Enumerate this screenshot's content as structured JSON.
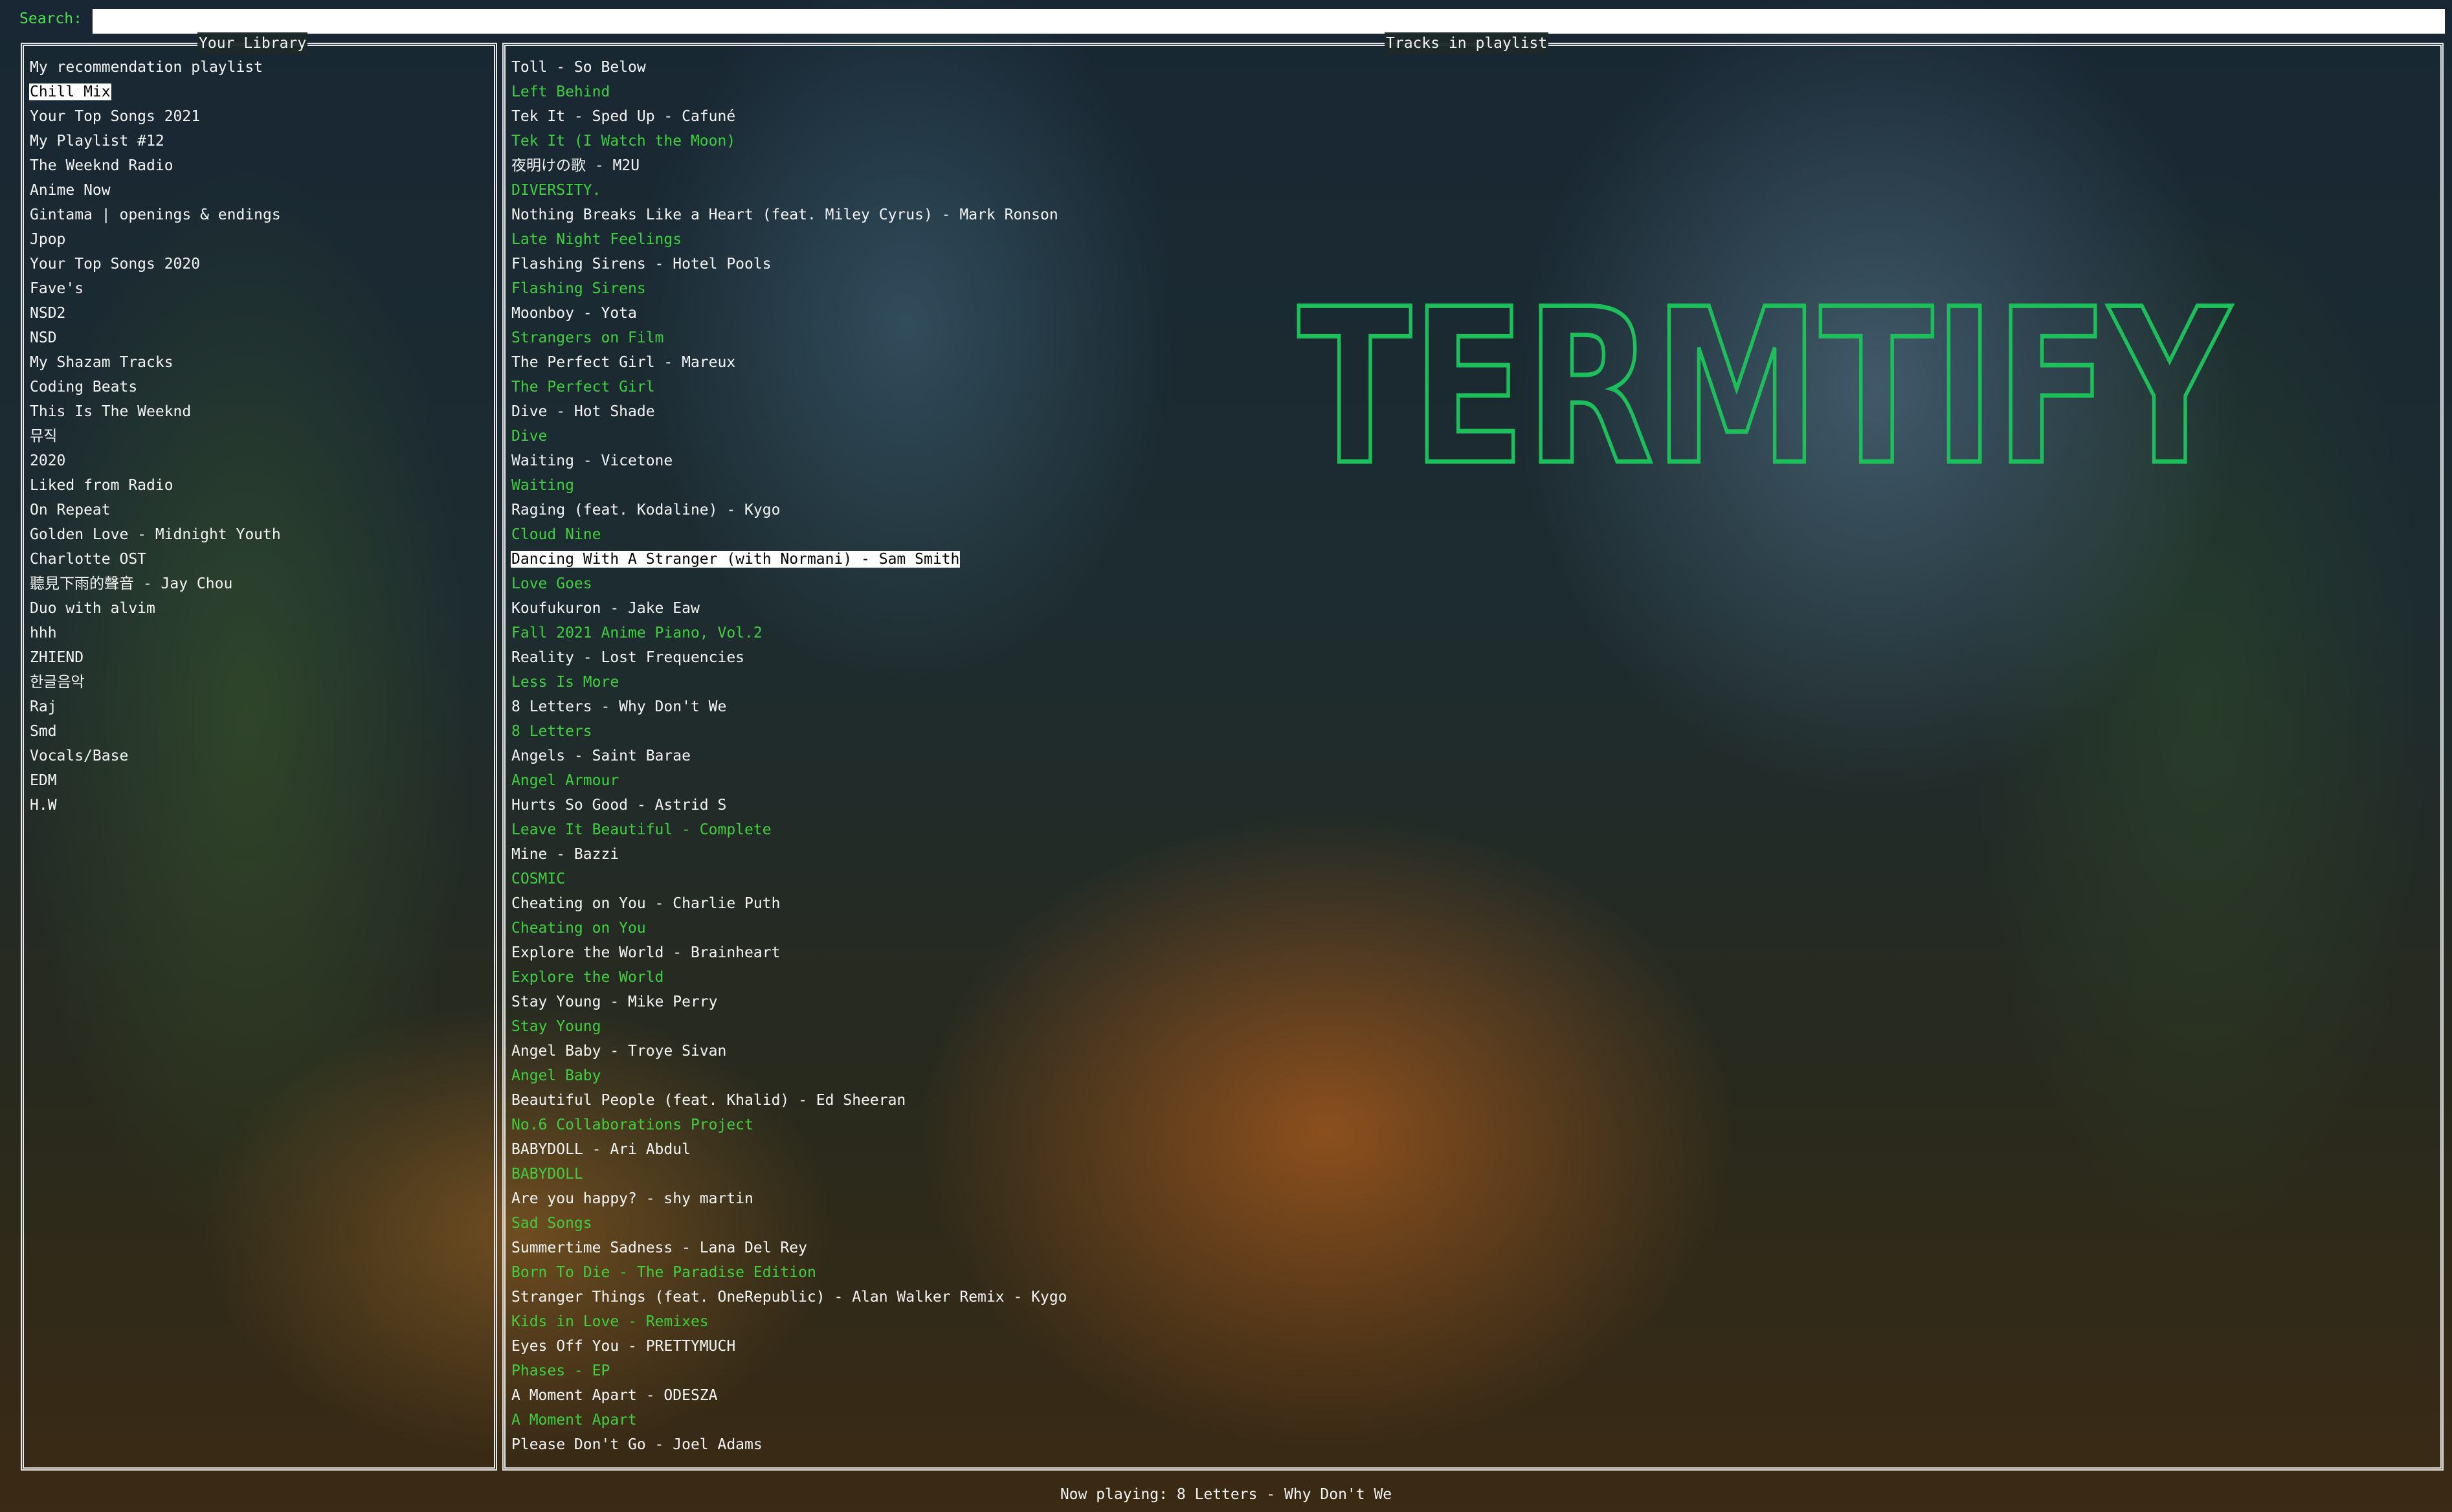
{
  "search": {
    "label": "Search:",
    "value": ""
  },
  "library": {
    "title": "Your Library",
    "selected_index": 1,
    "items": [
      "My recommendation playlist",
      "Chill Mix",
      "Your Top Songs 2021",
      "My Playlist #12",
      "The Weeknd Radio",
      "Anime Now",
      "Gintama | openings & endings",
      "Jpop",
      "Your Top Songs 2020",
      "Fave's",
      "NSD2",
      "NSD",
      "My Shazam Tracks",
      "Coding Beats",
      "This Is The Weeknd",
      "뮤직",
      "2020",
      "Liked from Radio",
      "On Repeat",
      "Golden Love - Midnight Youth",
      "Charlotte OST",
      "聽見下雨的聲音 - Jay Chou",
      "Duo with alvim",
      "hhh",
      "ZHIEND",
      "한글음악",
      "Raj",
      "Smd",
      "Vocals/Base",
      "EDM",
      "H.W"
    ]
  },
  "tracks": {
    "title": "Tracks in playlist",
    "selected_index": 20,
    "items": [
      {
        "text": "Toll - So Below",
        "kind": "track"
      },
      {
        "text": "Left Behind",
        "kind": "album"
      },
      {
        "text": "Tek It - Sped Up - Cafuné",
        "kind": "track"
      },
      {
        "text": "Tek It (I Watch the Moon)",
        "kind": "album"
      },
      {
        "text": "夜明けの歌 - M2U",
        "kind": "track"
      },
      {
        "text": "DIVERSITY.",
        "kind": "album"
      },
      {
        "text": "Nothing Breaks Like a Heart (feat. Miley Cyrus) - Mark Ronson",
        "kind": "track"
      },
      {
        "text": "Late Night Feelings",
        "kind": "album"
      },
      {
        "text": "Flashing Sirens - Hotel Pools",
        "kind": "track"
      },
      {
        "text": "Flashing Sirens",
        "kind": "album"
      },
      {
        "text": "Moonboy - Yota",
        "kind": "track"
      },
      {
        "text": "Strangers on Film",
        "kind": "album"
      },
      {
        "text": "The Perfect Girl - Mareux",
        "kind": "track"
      },
      {
        "text": "The Perfect Girl",
        "kind": "album"
      },
      {
        "text": "Dive - Hot Shade",
        "kind": "track"
      },
      {
        "text": "Dive",
        "kind": "album"
      },
      {
        "text": "Waiting - Vicetone",
        "kind": "track"
      },
      {
        "text": "Waiting",
        "kind": "album"
      },
      {
        "text": "Raging (feat. Kodaline) - Kygo",
        "kind": "track"
      },
      {
        "text": "Cloud Nine",
        "kind": "album"
      },
      {
        "text": "Dancing With A Stranger (with Normani) - Sam Smith",
        "kind": "track"
      },
      {
        "text": "Love Goes",
        "kind": "album"
      },
      {
        "text": "Koufukuron - Jake Eaw",
        "kind": "track"
      },
      {
        "text": "Fall 2021 Anime Piano, Vol.2",
        "kind": "album"
      },
      {
        "text": "Reality - Lost Frequencies",
        "kind": "track"
      },
      {
        "text": "Less Is More",
        "kind": "album"
      },
      {
        "text": "8 Letters - Why Don't We",
        "kind": "track"
      },
      {
        "text": "8 Letters",
        "kind": "album"
      },
      {
        "text": "Angels - Saint Barae",
        "kind": "track"
      },
      {
        "text": "Angel Armour",
        "kind": "album"
      },
      {
        "text": "Hurts So Good - Astrid S",
        "kind": "track"
      },
      {
        "text": "Leave It Beautiful - Complete",
        "kind": "album"
      },
      {
        "text": "Mine - Bazzi",
        "kind": "track"
      },
      {
        "text": "COSMIC",
        "kind": "album"
      },
      {
        "text": "Cheating on You - Charlie Puth",
        "kind": "track"
      },
      {
        "text": "Cheating on You",
        "kind": "album"
      },
      {
        "text": "Explore the World - Brainheart",
        "kind": "track"
      },
      {
        "text": "Explore the World",
        "kind": "album"
      },
      {
        "text": "Stay Young - Mike Perry",
        "kind": "track"
      },
      {
        "text": "Stay Young",
        "kind": "album"
      },
      {
        "text": "Angel Baby - Troye Sivan",
        "kind": "track"
      },
      {
        "text": "Angel Baby",
        "kind": "album"
      },
      {
        "text": "Beautiful People (feat. Khalid) - Ed Sheeran",
        "kind": "track"
      },
      {
        "text": "No.6 Collaborations Project",
        "kind": "album"
      },
      {
        "text": "BABYDOLL - Ari Abdul",
        "kind": "track"
      },
      {
        "text": "BABYDOLL",
        "kind": "album"
      },
      {
        "text": "Are you happy? - shy martin",
        "kind": "track"
      },
      {
        "text": "Sad Songs",
        "kind": "album"
      },
      {
        "text": "Summertime Sadness - Lana Del Rey",
        "kind": "track"
      },
      {
        "text": "Born To Die - The Paradise Edition",
        "kind": "album"
      },
      {
        "text": "Stranger Things (feat. OneRepublic) - Alan Walker Remix - Kygo",
        "kind": "track"
      },
      {
        "text": "Kids in Love - Remixes",
        "kind": "album"
      },
      {
        "text": "Eyes Off You - PRETTYMUCH",
        "kind": "track"
      },
      {
        "text": "Phases - EP",
        "kind": "album"
      },
      {
        "text": "A Moment Apart - ODESZA",
        "kind": "track"
      },
      {
        "text": "A Moment Apart",
        "kind": "album"
      },
      {
        "text": "Please Don't Go - Joel Adams",
        "kind": "track"
      }
    ]
  },
  "logo": {
    "text": "TERMTIFY",
    "color": "#1dbf5a"
  },
  "status": {
    "now_playing": "Now playing: 8 Letters - Why Don't We"
  },
  "colors": {
    "accent_green": "#3fcf3f",
    "text": "#f4f4f4",
    "selection_bg": "#ffffff",
    "selection_fg": "#000000"
  }
}
